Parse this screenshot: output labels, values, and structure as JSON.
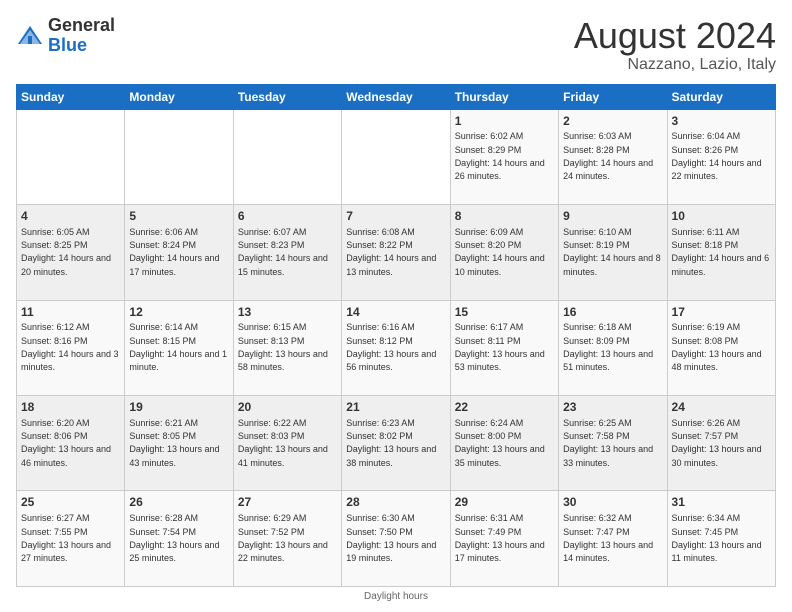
{
  "logo": {
    "general": "General",
    "blue": "Blue"
  },
  "header": {
    "title": "August 2024",
    "subtitle": "Nazzano, Lazio, Italy"
  },
  "days_of_week": [
    "Sunday",
    "Monday",
    "Tuesday",
    "Wednesday",
    "Thursday",
    "Friday",
    "Saturday"
  ],
  "weeks": [
    [
      {
        "day": "",
        "sunrise": "",
        "sunset": "",
        "daylight": ""
      },
      {
        "day": "",
        "sunrise": "",
        "sunset": "",
        "daylight": ""
      },
      {
        "day": "",
        "sunrise": "",
        "sunset": "",
        "daylight": ""
      },
      {
        "day": "",
        "sunrise": "",
        "sunset": "",
        "daylight": ""
      },
      {
        "day": "1",
        "sunrise": "Sunrise: 6:02 AM",
        "sunset": "Sunset: 8:29 PM",
        "daylight": "Daylight: 14 hours and 26 minutes."
      },
      {
        "day": "2",
        "sunrise": "Sunrise: 6:03 AM",
        "sunset": "Sunset: 8:28 PM",
        "daylight": "Daylight: 14 hours and 24 minutes."
      },
      {
        "day": "3",
        "sunrise": "Sunrise: 6:04 AM",
        "sunset": "Sunset: 8:26 PM",
        "daylight": "Daylight: 14 hours and 22 minutes."
      }
    ],
    [
      {
        "day": "4",
        "sunrise": "Sunrise: 6:05 AM",
        "sunset": "Sunset: 8:25 PM",
        "daylight": "Daylight: 14 hours and 20 minutes."
      },
      {
        "day": "5",
        "sunrise": "Sunrise: 6:06 AM",
        "sunset": "Sunset: 8:24 PM",
        "daylight": "Daylight: 14 hours and 17 minutes."
      },
      {
        "day": "6",
        "sunrise": "Sunrise: 6:07 AM",
        "sunset": "Sunset: 8:23 PM",
        "daylight": "Daylight: 14 hours and 15 minutes."
      },
      {
        "day": "7",
        "sunrise": "Sunrise: 6:08 AM",
        "sunset": "Sunset: 8:22 PM",
        "daylight": "Daylight: 14 hours and 13 minutes."
      },
      {
        "day": "8",
        "sunrise": "Sunrise: 6:09 AM",
        "sunset": "Sunset: 8:20 PM",
        "daylight": "Daylight: 14 hours and 10 minutes."
      },
      {
        "day": "9",
        "sunrise": "Sunrise: 6:10 AM",
        "sunset": "Sunset: 8:19 PM",
        "daylight": "Daylight: 14 hours and 8 minutes."
      },
      {
        "day": "10",
        "sunrise": "Sunrise: 6:11 AM",
        "sunset": "Sunset: 8:18 PM",
        "daylight": "Daylight: 14 hours and 6 minutes."
      }
    ],
    [
      {
        "day": "11",
        "sunrise": "Sunrise: 6:12 AM",
        "sunset": "Sunset: 8:16 PM",
        "daylight": "Daylight: 14 hours and 3 minutes."
      },
      {
        "day": "12",
        "sunrise": "Sunrise: 6:14 AM",
        "sunset": "Sunset: 8:15 PM",
        "daylight": "Daylight: 14 hours and 1 minute."
      },
      {
        "day": "13",
        "sunrise": "Sunrise: 6:15 AM",
        "sunset": "Sunset: 8:13 PM",
        "daylight": "Daylight: 13 hours and 58 minutes."
      },
      {
        "day": "14",
        "sunrise": "Sunrise: 6:16 AM",
        "sunset": "Sunset: 8:12 PM",
        "daylight": "Daylight: 13 hours and 56 minutes."
      },
      {
        "day": "15",
        "sunrise": "Sunrise: 6:17 AM",
        "sunset": "Sunset: 8:11 PM",
        "daylight": "Daylight: 13 hours and 53 minutes."
      },
      {
        "day": "16",
        "sunrise": "Sunrise: 6:18 AM",
        "sunset": "Sunset: 8:09 PM",
        "daylight": "Daylight: 13 hours and 51 minutes."
      },
      {
        "day": "17",
        "sunrise": "Sunrise: 6:19 AM",
        "sunset": "Sunset: 8:08 PM",
        "daylight": "Daylight: 13 hours and 48 minutes."
      }
    ],
    [
      {
        "day": "18",
        "sunrise": "Sunrise: 6:20 AM",
        "sunset": "Sunset: 8:06 PM",
        "daylight": "Daylight: 13 hours and 46 minutes."
      },
      {
        "day": "19",
        "sunrise": "Sunrise: 6:21 AM",
        "sunset": "Sunset: 8:05 PM",
        "daylight": "Daylight: 13 hours and 43 minutes."
      },
      {
        "day": "20",
        "sunrise": "Sunrise: 6:22 AM",
        "sunset": "Sunset: 8:03 PM",
        "daylight": "Daylight: 13 hours and 41 minutes."
      },
      {
        "day": "21",
        "sunrise": "Sunrise: 6:23 AM",
        "sunset": "Sunset: 8:02 PM",
        "daylight": "Daylight: 13 hours and 38 minutes."
      },
      {
        "day": "22",
        "sunrise": "Sunrise: 6:24 AM",
        "sunset": "Sunset: 8:00 PM",
        "daylight": "Daylight: 13 hours and 35 minutes."
      },
      {
        "day": "23",
        "sunrise": "Sunrise: 6:25 AM",
        "sunset": "Sunset: 7:58 PM",
        "daylight": "Daylight: 13 hours and 33 minutes."
      },
      {
        "day": "24",
        "sunrise": "Sunrise: 6:26 AM",
        "sunset": "Sunset: 7:57 PM",
        "daylight": "Daylight: 13 hours and 30 minutes."
      }
    ],
    [
      {
        "day": "25",
        "sunrise": "Sunrise: 6:27 AM",
        "sunset": "Sunset: 7:55 PM",
        "daylight": "Daylight: 13 hours and 27 minutes."
      },
      {
        "day": "26",
        "sunrise": "Sunrise: 6:28 AM",
        "sunset": "Sunset: 7:54 PM",
        "daylight": "Daylight: 13 hours and 25 minutes."
      },
      {
        "day": "27",
        "sunrise": "Sunrise: 6:29 AM",
        "sunset": "Sunset: 7:52 PM",
        "daylight": "Daylight: 13 hours and 22 minutes."
      },
      {
        "day": "28",
        "sunrise": "Sunrise: 6:30 AM",
        "sunset": "Sunset: 7:50 PM",
        "daylight": "Daylight: 13 hours and 19 minutes."
      },
      {
        "day": "29",
        "sunrise": "Sunrise: 6:31 AM",
        "sunset": "Sunset: 7:49 PM",
        "daylight": "Daylight: 13 hours and 17 minutes."
      },
      {
        "day": "30",
        "sunrise": "Sunrise: 6:32 AM",
        "sunset": "Sunset: 7:47 PM",
        "daylight": "Daylight: 13 hours and 14 minutes."
      },
      {
        "day": "31",
        "sunrise": "Sunrise: 6:34 AM",
        "sunset": "Sunset: 7:45 PM",
        "daylight": "Daylight: 13 hours and 11 minutes."
      }
    ]
  ],
  "footer": {
    "daylight_label": "Daylight hours"
  }
}
